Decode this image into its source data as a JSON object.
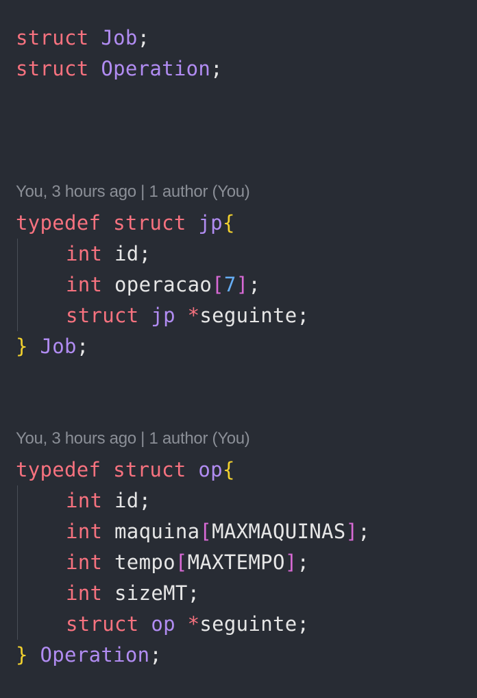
{
  "editor": {
    "forward_decls": [
      {
        "keyword": "struct",
        "name": "Job",
        "end": ";"
      },
      {
        "keyword": "struct",
        "name": "Operation",
        "end": ";"
      }
    ],
    "codelens": [
      {
        "text": "You, 3 hours ago | 1 author (You)"
      },
      {
        "text": "You, 3 hours ago | 1 author (You)"
      }
    ],
    "job_block": {
      "typedef": "typedef",
      "struct": "struct",
      "tag": "jp",
      "open": "{",
      "f1_type": "int",
      "f1_name": "id",
      "f1_end": ";",
      "f2_type": "int",
      "f2_name": "operacao",
      "f2_lb": "[",
      "f2_size": "7",
      "f2_rb": "]",
      "f2_end": ";",
      "f3_kw": "struct",
      "f3_type": "jp",
      "f3_ptr": "*",
      "f3_name": "seguinte",
      "f3_end": ";",
      "close": "}",
      "alias": "Job",
      "end": ";"
    },
    "op_block": {
      "typedef": "typedef",
      "struct": "struct",
      "tag": "op",
      "open": "{",
      "f1_type": "int",
      "f1_name": "id",
      "f1_end": ";",
      "f2_type": "int",
      "f2_name": "maquina",
      "f2_lb": "[",
      "f2_size": "MAXMAQUINAS",
      "f2_rb": "]",
      "f2_end": ";",
      "f3_type": "int",
      "f3_name": "tempo",
      "f3_lb": "[",
      "f3_size": "MAXTEMPO",
      "f3_rb": "]",
      "f3_end": ";",
      "f4_type": "int",
      "f4_name": "sizeMT",
      "f4_end": ";",
      "f5_kw": "struct",
      "f5_type": "op",
      "f5_ptr": "*",
      "f5_name": "seguinte",
      "f5_end": ";",
      "close": "}",
      "alias": "Operation",
      "end": ";"
    }
  },
  "colors": {
    "background": "#282c34",
    "keyword": "#f7727f",
    "type": "#b18cf2",
    "brace": "#f2d12e",
    "bracket": "#d96ad6",
    "number": "#66aef5",
    "text": "#e6e6e6",
    "codelens": "#8b8f97"
  }
}
